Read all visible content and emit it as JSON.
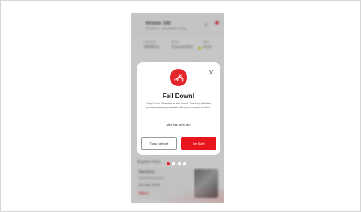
{
  "background": {
    "vehicle_name": "Xtreme 160 ",
    "vehicle_sub": "Windshield - Last updated 2h ago",
    "stats": [
      {
        "label": "Odometer",
        "value": "8000km"
      },
      {
        "label": "Status",
        "value": "Connected"
      },
      {
        "label": "Alert",
        "value": "Alert"
      }
    ],
    "section_title": "Explore Hero",
    "card": {
      "title": "Service",
      "subtitle": "Next service due on",
      "date": "08 July, 2023"
    },
    "brand": "Hero"
  },
  "modal": {
    "icon": "fall-alert-icon",
    "title": "Fell Down!",
    "message": "Oops! Your Xtreme just fell down! The App will alert your emergency contacts with your current location.",
    "alert_status": "Alert has been sent",
    "track_button": "Track Vehicle",
    "safe_button": "I'm Safe"
  },
  "pager": {
    "count": 4,
    "active_index": 0
  },
  "colors": {
    "accent": "#e5252a",
    "overlay": "#787878"
  }
}
